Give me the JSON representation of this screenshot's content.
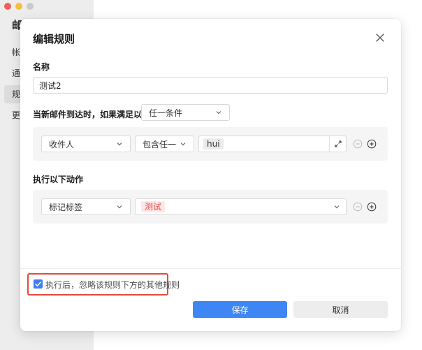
{
  "background": {
    "window_title": "邮",
    "nav_items": [
      "帐",
      "通",
      "规",
      "更"
    ]
  },
  "dialog": {
    "title": "编辑规则",
    "name_label": "名称",
    "name_value": "测试2",
    "condition_prefix": "当新邮件到达时，如果满足以下",
    "condition_match": "任一条件",
    "condition_row": {
      "field": "收件人",
      "operator": "包含任一",
      "value_tag": "hui"
    },
    "actions_label": "执行以下动作",
    "action_row": {
      "action": "标记标签",
      "tag": "测试"
    },
    "stop_checkbox_label": "执行后，忽略该规则下方的其他规则",
    "stop_checked": true,
    "save_label": "保存",
    "cancel_label": "取消"
  },
  "colors": {
    "primary": "#3d86f4",
    "highlight": "#e44b3a",
    "tag_red": "#e84949"
  }
}
